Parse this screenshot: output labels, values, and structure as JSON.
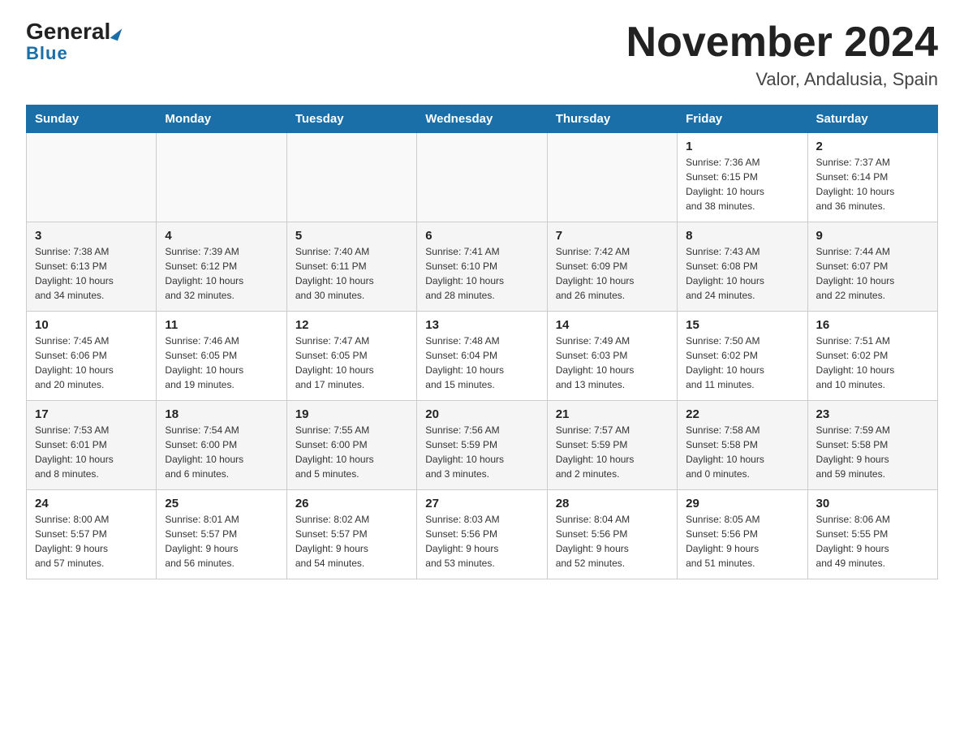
{
  "header": {
    "logo_general": "General",
    "logo_blue": "Blue",
    "month_title": "November 2024",
    "location": "Valor, Andalusia, Spain"
  },
  "weekdays": [
    "Sunday",
    "Monday",
    "Tuesday",
    "Wednesday",
    "Thursday",
    "Friday",
    "Saturday"
  ],
  "weeks": [
    [
      {
        "day": "",
        "info": ""
      },
      {
        "day": "",
        "info": ""
      },
      {
        "day": "",
        "info": ""
      },
      {
        "day": "",
        "info": ""
      },
      {
        "day": "",
        "info": ""
      },
      {
        "day": "1",
        "info": "Sunrise: 7:36 AM\nSunset: 6:15 PM\nDaylight: 10 hours\nand 38 minutes."
      },
      {
        "day": "2",
        "info": "Sunrise: 7:37 AM\nSunset: 6:14 PM\nDaylight: 10 hours\nand 36 minutes."
      }
    ],
    [
      {
        "day": "3",
        "info": "Sunrise: 7:38 AM\nSunset: 6:13 PM\nDaylight: 10 hours\nand 34 minutes."
      },
      {
        "day": "4",
        "info": "Sunrise: 7:39 AM\nSunset: 6:12 PM\nDaylight: 10 hours\nand 32 minutes."
      },
      {
        "day": "5",
        "info": "Sunrise: 7:40 AM\nSunset: 6:11 PM\nDaylight: 10 hours\nand 30 minutes."
      },
      {
        "day": "6",
        "info": "Sunrise: 7:41 AM\nSunset: 6:10 PM\nDaylight: 10 hours\nand 28 minutes."
      },
      {
        "day": "7",
        "info": "Sunrise: 7:42 AM\nSunset: 6:09 PM\nDaylight: 10 hours\nand 26 minutes."
      },
      {
        "day": "8",
        "info": "Sunrise: 7:43 AM\nSunset: 6:08 PM\nDaylight: 10 hours\nand 24 minutes."
      },
      {
        "day": "9",
        "info": "Sunrise: 7:44 AM\nSunset: 6:07 PM\nDaylight: 10 hours\nand 22 minutes."
      }
    ],
    [
      {
        "day": "10",
        "info": "Sunrise: 7:45 AM\nSunset: 6:06 PM\nDaylight: 10 hours\nand 20 minutes."
      },
      {
        "day": "11",
        "info": "Sunrise: 7:46 AM\nSunset: 6:05 PM\nDaylight: 10 hours\nand 19 minutes."
      },
      {
        "day": "12",
        "info": "Sunrise: 7:47 AM\nSunset: 6:05 PM\nDaylight: 10 hours\nand 17 minutes."
      },
      {
        "day": "13",
        "info": "Sunrise: 7:48 AM\nSunset: 6:04 PM\nDaylight: 10 hours\nand 15 minutes."
      },
      {
        "day": "14",
        "info": "Sunrise: 7:49 AM\nSunset: 6:03 PM\nDaylight: 10 hours\nand 13 minutes."
      },
      {
        "day": "15",
        "info": "Sunrise: 7:50 AM\nSunset: 6:02 PM\nDaylight: 10 hours\nand 11 minutes."
      },
      {
        "day": "16",
        "info": "Sunrise: 7:51 AM\nSunset: 6:02 PM\nDaylight: 10 hours\nand 10 minutes."
      }
    ],
    [
      {
        "day": "17",
        "info": "Sunrise: 7:53 AM\nSunset: 6:01 PM\nDaylight: 10 hours\nand 8 minutes."
      },
      {
        "day": "18",
        "info": "Sunrise: 7:54 AM\nSunset: 6:00 PM\nDaylight: 10 hours\nand 6 minutes."
      },
      {
        "day": "19",
        "info": "Sunrise: 7:55 AM\nSunset: 6:00 PM\nDaylight: 10 hours\nand 5 minutes."
      },
      {
        "day": "20",
        "info": "Sunrise: 7:56 AM\nSunset: 5:59 PM\nDaylight: 10 hours\nand 3 minutes."
      },
      {
        "day": "21",
        "info": "Sunrise: 7:57 AM\nSunset: 5:59 PM\nDaylight: 10 hours\nand 2 minutes."
      },
      {
        "day": "22",
        "info": "Sunrise: 7:58 AM\nSunset: 5:58 PM\nDaylight: 10 hours\nand 0 minutes."
      },
      {
        "day": "23",
        "info": "Sunrise: 7:59 AM\nSunset: 5:58 PM\nDaylight: 9 hours\nand 59 minutes."
      }
    ],
    [
      {
        "day": "24",
        "info": "Sunrise: 8:00 AM\nSunset: 5:57 PM\nDaylight: 9 hours\nand 57 minutes."
      },
      {
        "day": "25",
        "info": "Sunrise: 8:01 AM\nSunset: 5:57 PM\nDaylight: 9 hours\nand 56 minutes."
      },
      {
        "day": "26",
        "info": "Sunrise: 8:02 AM\nSunset: 5:57 PM\nDaylight: 9 hours\nand 54 minutes."
      },
      {
        "day": "27",
        "info": "Sunrise: 8:03 AM\nSunset: 5:56 PM\nDaylight: 9 hours\nand 53 minutes."
      },
      {
        "day": "28",
        "info": "Sunrise: 8:04 AM\nSunset: 5:56 PM\nDaylight: 9 hours\nand 52 minutes."
      },
      {
        "day": "29",
        "info": "Sunrise: 8:05 AM\nSunset: 5:56 PM\nDaylight: 9 hours\nand 51 minutes."
      },
      {
        "day": "30",
        "info": "Sunrise: 8:06 AM\nSunset: 5:55 PM\nDaylight: 9 hours\nand 49 minutes."
      }
    ]
  ]
}
